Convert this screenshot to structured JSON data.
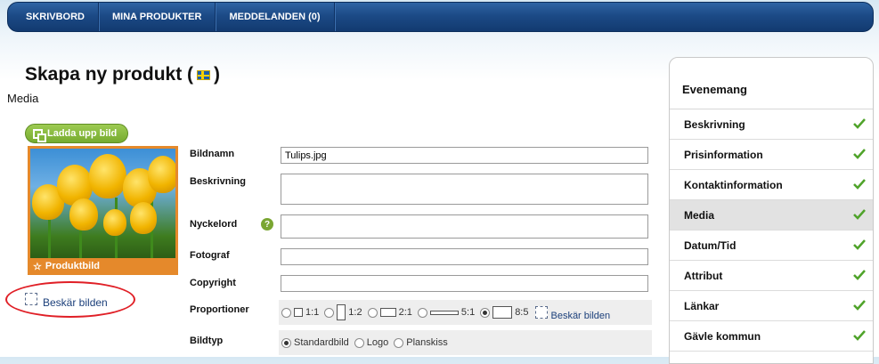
{
  "nav": [
    "SKRIVBORD",
    "MINA PRODUKTER",
    "MEDDELANDEN (0)"
  ],
  "page_title": "Skapa ny produkt (",
  "page_title_close": ")",
  "section": "Media",
  "upload_button": "Ladda upp bild",
  "photo_caption": "Produktbild",
  "crop_link": "Beskär bilden",
  "form": {
    "bildnamn_label": "Bildnamn",
    "bildnamn_value": "Tulips.jpg",
    "beskrivning_label": "Beskrivning",
    "nyckelord_label": "Nyckelord",
    "help_glyph": "?",
    "fotograf_label": "Fotograf",
    "copyright_label": "Copyright",
    "proportioner_label": "Proportioner",
    "proportions": [
      "1:1",
      "1:2",
      "2:1",
      "5:1",
      "8:5"
    ],
    "proportion_selected": "8:5",
    "crop_link": "Beskär bilden",
    "bildtyp_label": "Bildtyp",
    "bildtyp_options": [
      "Standardbild",
      "Logo",
      "Planskiss"
    ],
    "bildtyp_selected": "Standardbild"
  },
  "sidebar": {
    "title": "Evenemang",
    "items": [
      "Beskrivning",
      "Prisinformation",
      "Kontaktinformation",
      "Media",
      "Datum/Tid",
      "Attribut",
      "Länkar",
      "Gävle kommun"
    ],
    "active": "Media"
  },
  "colors": {
    "nav_bg": "#1c4a86",
    "upload_green": "#76ab2f",
    "photo_frame": "#e5892b",
    "highlight": "#e01f26",
    "check": "#4fa32a"
  }
}
